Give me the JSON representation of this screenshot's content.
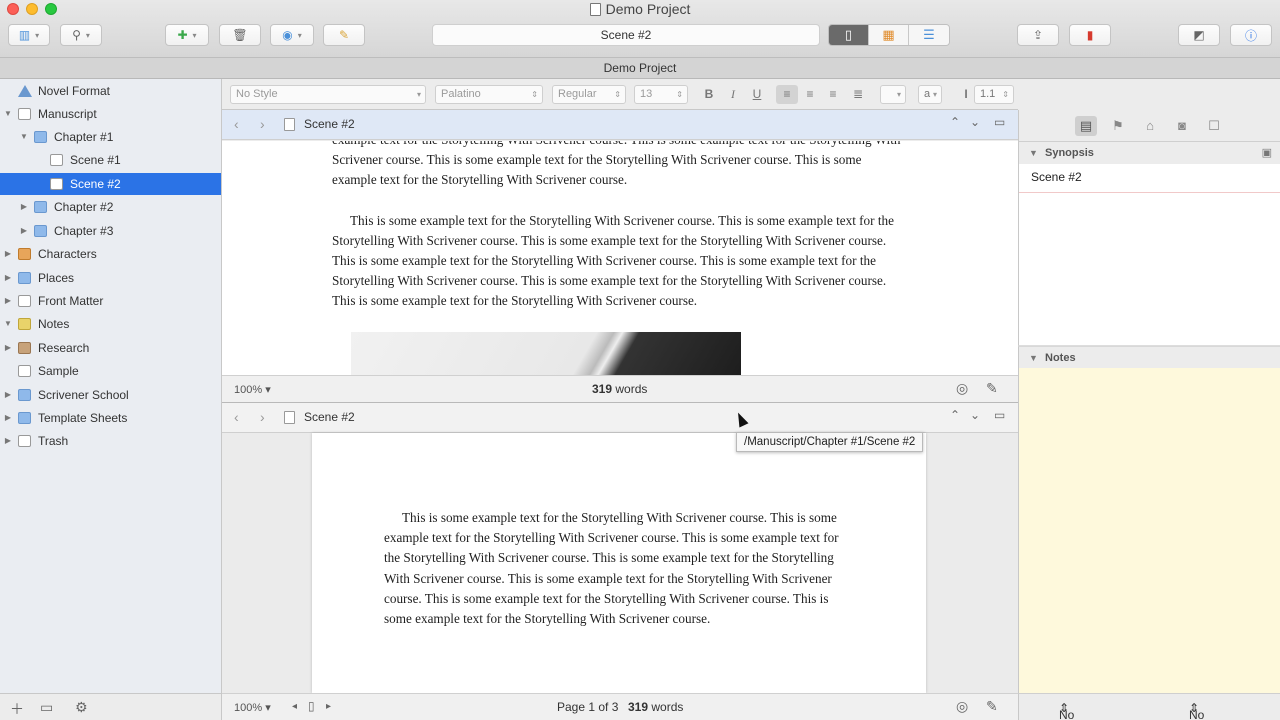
{
  "window": {
    "title": "Demo Project",
    "project_bar": "Demo Project",
    "toolbar": {
      "document_field": "Scene #2"
    }
  },
  "colors": {
    "selection": "#2b73e6",
    "notes_bg": "#fef9dc",
    "traffic_close": "#fc5f57",
    "traffic_min": "#fdbc2e",
    "traffic_max": "#28c840"
  },
  "binder": {
    "items": [
      {
        "label": "Novel Format",
        "icon": "novel-format-icon"
      },
      {
        "label": "Manuscript",
        "icon": "manuscript-icon"
      },
      {
        "label": "Chapter #1",
        "icon": "folder-icon"
      },
      {
        "label": "Scene #1",
        "icon": "document-icon"
      },
      {
        "label": "Scene #2",
        "icon": "document-icon"
      },
      {
        "label": "Chapter #2",
        "icon": "folder-icon"
      },
      {
        "label": "Chapter #3",
        "icon": "folder-icon"
      },
      {
        "label": "Characters",
        "icon": "characters-icon"
      },
      {
        "label": "Places",
        "icon": "places-icon"
      },
      {
        "label": "Front Matter",
        "icon": "front-matter-icon"
      },
      {
        "label": "Notes",
        "icon": "notes-icon"
      },
      {
        "label": "Research",
        "icon": "research-icon"
      },
      {
        "label": "Sample",
        "icon": "document-icon"
      },
      {
        "label": "Scrivener School",
        "icon": "folder-icon"
      },
      {
        "label": "Template Sheets",
        "icon": "folder-icon"
      },
      {
        "label": "Trash",
        "icon": "trash-icon"
      }
    ],
    "selected": "Scene #2"
  },
  "format_bar": {
    "style": "No Style",
    "font": "Palatino",
    "weight": "Regular",
    "size": "13",
    "line_spacing": "1.1",
    "text_color": "a"
  },
  "editor_top": {
    "header_title": "Scene #2",
    "paragraph_partial_first": "example text for the Storytelling With Scrivener course. This is some example text for the Storytelling With Scrivener course. This is some example text for the Storytelling With Scrivener course. This is some example text for the Storytelling With Scrivener course.",
    "paragraph_full": "This is some example text for the Storytelling With Scrivener course. This is some example text for the Storytelling With Scrivener course. This is some example text for the Storytelling With Scrivener course. This is some example text for the Storytelling With Scrivener course. This is some example text for the Storytelling With Scrivener course. This is some example text for the Storytelling With Scrivener course. This is some example text for the Storytelling With Scrivener course.",
    "zoom": "100%",
    "word_count_num": "319",
    "word_count_unit": "words"
  },
  "editor_bottom": {
    "header_title": "Scene #2",
    "paragraph": "This is some example text for the Storytelling With Scrivener course. This is some example text for the Storytelling With Scrivener course. This is some example text for the Storytelling With Scrivener course. This is some example text for the Storytelling With Scrivener course. This is some example text for the Storytelling With Scrivener course. This is some example text for the Storytelling With Scrivener course. This is some example text for the Storytelling With Scrivener course.",
    "zoom": "100%",
    "page_info": "Page 1 of 3",
    "word_count_num": "319",
    "word_count_unit": "words"
  },
  "tooltip": "/Manuscript/Chapter #1/Scene #2",
  "inspector": {
    "synopsis_header": "Synopsis",
    "synopsis_title": "Scene #2",
    "notes_header": "Notes",
    "label_select": "No Label",
    "status_select": "No Status"
  }
}
